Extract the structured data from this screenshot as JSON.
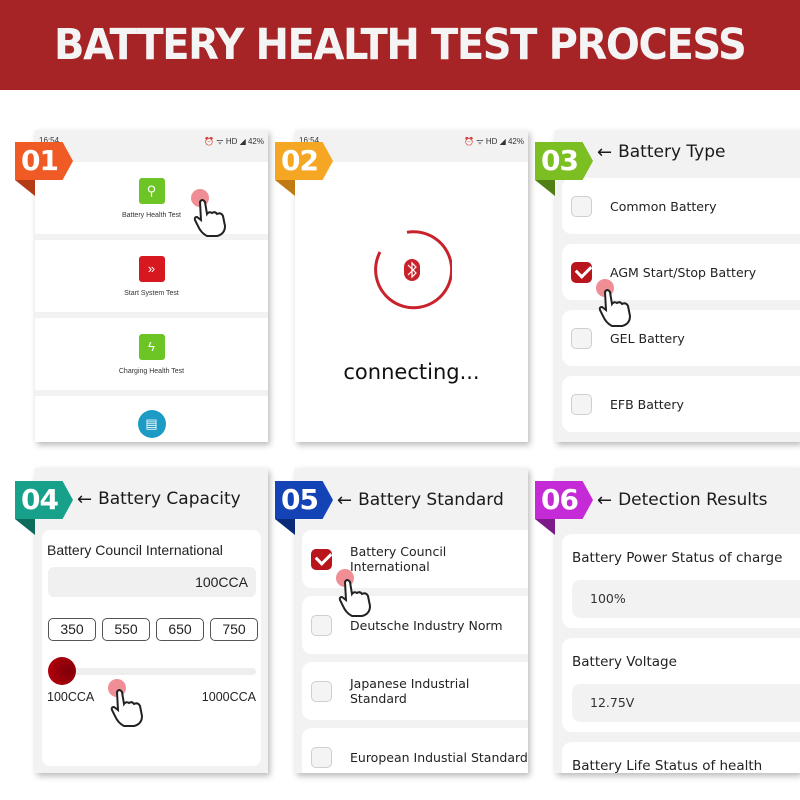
{
  "banner": {
    "title": "BATTERY HEALTH TEST PROCESS"
  },
  "colors": {
    "banner": "#a72426",
    "step1": "#f05a24",
    "step2": "#f5a623",
    "step3": "#7cbf22",
    "step4": "#17a08a",
    "step5": "#1343b4",
    "step6": "#c42bd6",
    "accent_red": "#b8151c"
  },
  "steps": [
    {
      "number": "01",
      "status_bar": {
        "time": "16:54",
        "icons": "⏰ ᯤ HD ◢",
        "battery": "42%"
      },
      "menu": [
        {
          "label": "Battery Health Test",
          "icon": "battery-search-icon"
        },
        {
          "label": "Start System Test",
          "icon": "car-start-icon"
        },
        {
          "label": "Charging Health Test",
          "icon": "battery-charge-icon"
        },
        {
          "label": "",
          "icon": "history-report-icon"
        }
      ]
    },
    {
      "number": "02",
      "status_bar": {
        "time": "16:54",
        "icons": "⏰ ᯤ HD ◢",
        "battery": "42%"
      },
      "status_text": "connecting...",
      "icon": "bluetooth-icon"
    },
    {
      "number": "03",
      "header": "Battery Type",
      "options": [
        {
          "label": "Common Battery",
          "checked": false
        },
        {
          "label": "AGM Start/Stop Battery",
          "checked": true
        },
        {
          "label": "GEL Battery",
          "checked": false
        },
        {
          "label": "EFB Battery",
          "checked": false
        }
      ]
    },
    {
      "number": "04",
      "header": "Battery Capacity",
      "standard": "Battery Council International",
      "value": "100CCA",
      "presets": [
        "350",
        "550",
        "650",
        "750"
      ],
      "slider": {
        "min_label": "100CCA",
        "max_label": "1000CCA",
        "min": 100,
        "max": 1000,
        "value": 100
      }
    },
    {
      "number": "05",
      "header": "Battery Standard",
      "options": [
        {
          "label": "Battery Council International",
          "checked": true
        },
        {
          "label": "Deutsche Industry Norm",
          "checked": false
        },
        {
          "label": "Japanese Industrial Standard",
          "checked": false
        },
        {
          "label": "European Industial Standard",
          "checked": false
        }
      ]
    },
    {
      "number": "06",
      "header": "Detection Results",
      "results": [
        {
          "label": "Battery Power Status of charge",
          "value": "100%"
        },
        {
          "label": "Battery Voltage",
          "value": "12.75V"
        },
        {
          "label": "Battery Life Status of health",
          "value": ""
        }
      ]
    }
  ]
}
